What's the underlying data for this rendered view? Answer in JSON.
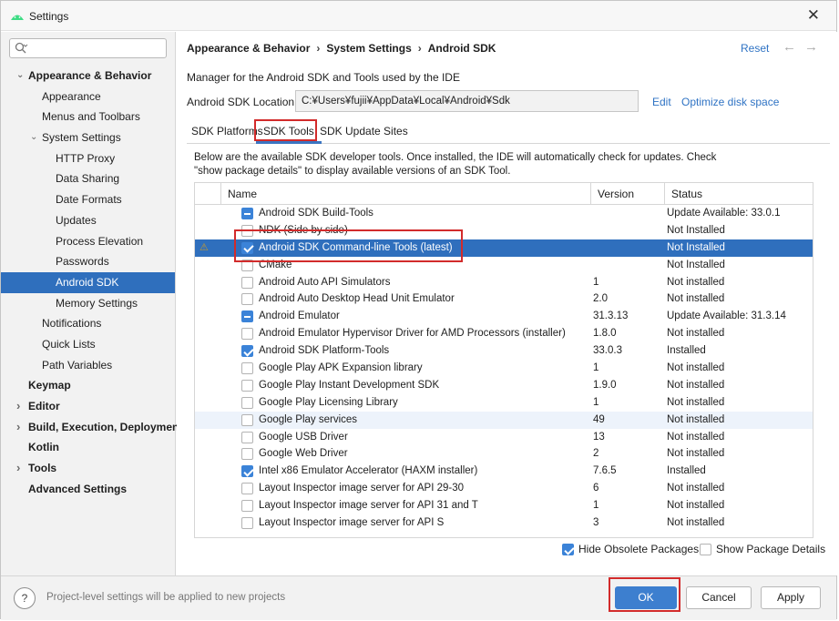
{
  "window": {
    "title": "Settings",
    "close_glyph": "✕"
  },
  "search": {
    "value": "",
    "placeholder": ""
  },
  "sidebar": {
    "items": [
      {
        "label": "Appearance & Behavior",
        "indent": 0,
        "arrow": "expanded",
        "bold": true
      },
      {
        "label": "Appearance",
        "indent": 1
      },
      {
        "label": "Menus and Toolbars",
        "indent": 1
      },
      {
        "label": "System Settings",
        "indent": 1,
        "arrow": "expanded"
      },
      {
        "label": "HTTP Proxy",
        "indent": 2
      },
      {
        "label": "Data Sharing",
        "indent": 2
      },
      {
        "label": "Date Formats",
        "indent": 2
      },
      {
        "label": "Updates",
        "indent": 2
      },
      {
        "label": "Process Elevation",
        "indent": 2
      },
      {
        "label": "Passwords",
        "indent": 2
      },
      {
        "label": "Android SDK",
        "indent": 2,
        "selected": true
      },
      {
        "label": "Memory Settings",
        "indent": 2
      },
      {
        "label": "Notifications",
        "indent": 1
      },
      {
        "label": "Quick Lists",
        "indent": 1
      },
      {
        "label": "Path Variables",
        "indent": 1
      },
      {
        "label": "Keymap",
        "indent": 0,
        "bold": true
      },
      {
        "label": "Editor",
        "indent": 0,
        "arrow": "collapsed",
        "bold": true
      },
      {
        "label": "Build, Execution, Deployment",
        "indent": 0,
        "arrow": "collapsed",
        "bold": true
      },
      {
        "label": "Kotlin",
        "indent": 0,
        "bold": true
      },
      {
        "label": "Tools",
        "indent": 0,
        "arrow": "collapsed",
        "bold": true
      },
      {
        "label": "Advanced Settings",
        "indent": 0,
        "bold": true
      }
    ]
  },
  "header": {
    "breadcrumb": [
      "Appearance & Behavior",
      "System Settings",
      "Android SDK"
    ],
    "separator": "›",
    "reset": "Reset",
    "back_glyph": "←",
    "forward_glyph": "→"
  },
  "main": {
    "description": "Manager for the Android SDK and Tools used by the IDE",
    "location_label": "Android SDK Location:",
    "location_value": "C:¥Users¥fujii¥AppData¥Local¥Android¥Sdk",
    "edit": "Edit",
    "optimize": "Optimize disk space",
    "tabs": [
      {
        "label": "SDK Platforms"
      },
      {
        "label": "SDK Tools",
        "active": true
      },
      {
        "label": "SDK Update Sites"
      }
    ],
    "info_line1": "Below are the available SDK developer tools. Once installed, the IDE will automatically check for updates. Check",
    "info_line2": "\"show package details\" to display available versions of an SDK Tool.",
    "columns": {
      "name": "Name",
      "version": "Version",
      "status": "Status"
    },
    "rows": [
      {
        "name": "Android SDK Build-Tools",
        "version": "",
        "status": "Update Available: 33.0.1",
        "check": "partial"
      },
      {
        "name": "NDK (Side by side)",
        "version": "",
        "status": "Not Installed",
        "check": "none"
      },
      {
        "name": "Android SDK Command-line Tools (latest)",
        "version": "",
        "status": "Not Installed",
        "check": "checked",
        "selected": true,
        "warn": "⚠"
      },
      {
        "name": "CMake",
        "version": "",
        "status": "Not Installed",
        "check": "none"
      },
      {
        "name": "Android Auto API Simulators",
        "version": "1",
        "status": "Not installed",
        "check": "none"
      },
      {
        "name": "Android Auto Desktop Head Unit Emulator",
        "version": "2.0",
        "status": "Not installed",
        "check": "none"
      },
      {
        "name": "Android Emulator",
        "version": "31.3.13",
        "status": "Update Available: 31.3.14",
        "check": "partial"
      },
      {
        "name": "Android Emulator Hypervisor Driver for AMD Processors (installer)",
        "version": "1.8.0",
        "status": "Not installed",
        "check": "none"
      },
      {
        "name": "Android SDK Platform-Tools",
        "version": "33.0.3",
        "status": "Installed",
        "check": "checked"
      },
      {
        "name": "Google Play APK Expansion library",
        "version": "1",
        "status": "Not installed",
        "check": "none"
      },
      {
        "name": "Google Play Instant Development SDK",
        "version": "1.9.0",
        "status": "Not installed",
        "check": "none"
      },
      {
        "name": "Google Play Licensing Library",
        "version": "1",
        "status": "Not installed",
        "check": "none"
      },
      {
        "name": "Google Play services",
        "version": "49",
        "status": "Not installed",
        "check": "none",
        "hover": true
      },
      {
        "name": "Google USB Driver",
        "version": "13",
        "status": "Not installed",
        "check": "none"
      },
      {
        "name": "Google Web Driver",
        "version": "2",
        "status": "Not installed",
        "check": "none"
      },
      {
        "name": "Intel x86 Emulator Accelerator (HAXM installer)",
        "version": "7.6.5",
        "status": "Installed",
        "check": "checked"
      },
      {
        "name": "Layout Inspector image server for API 29-30",
        "version": "6",
        "status": "Not installed",
        "check": "none"
      },
      {
        "name": "Layout Inspector image server for API 31 and T",
        "version": "1",
        "status": "Not installed",
        "check": "none"
      },
      {
        "name": "Layout Inspector image server for API S",
        "version": "3",
        "status": "Not installed",
        "check": "none"
      }
    ],
    "hide_obsolete": "Hide Obsolete Packages",
    "show_details": "Show Package Details"
  },
  "footer": {
    "help_glyph": "?",
    "note": "Project-level settings will be applied to new projects",
    "ok": "OK",
    "cancel": "Cancel",
    "apply": "Apply"
  },
  "colors": {
    "accent": "#2f6fbd",
    "link": "#2f73c4",
    "highlight_box": "#d22b2b",
    "checkbox": "#3b83d8"
  }
}
